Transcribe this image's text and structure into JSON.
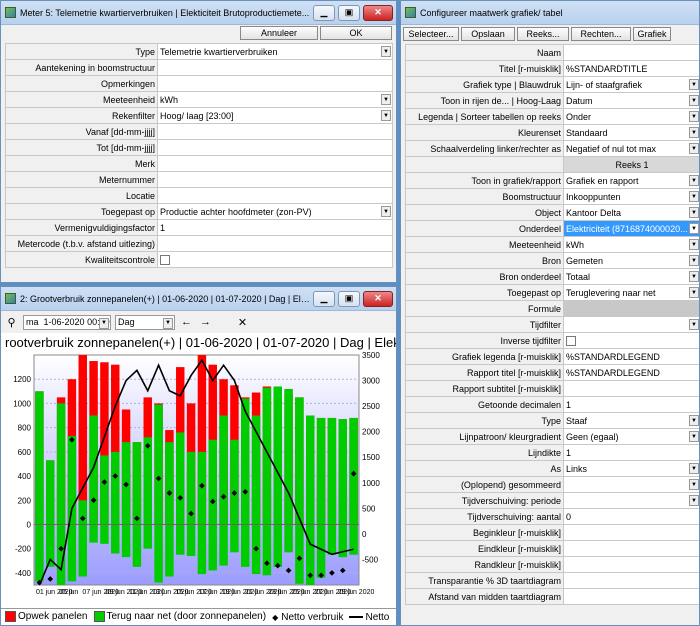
{
  "meter": {
    "title": "Meter 5: Telemetrie kwartierverbruiken | Elekticiteit Brutoproductiemete...",
    "cancel_label": "Annuleer",
    "ok_label": "OK",
    "fields": [
      {
        "label": "Type",
        "value": "Telemetrie kwartierverbruiken",
        "dropdown": true
      },
      {
        "label": "Aantekening in boomstructuur",
        "value": ""
      },
      {
        "label": "Opmerkingen",
        "value": ""
      },
      {
        "label": "Meeteenheid",
        "value": "kWh",
        "dropdown": true
      },
      {
        "label": "Rekenfilter",
        "value": "Hoog/ laag [23:00]",
        "dropdown": true,
        "icon": "filter-icon"
      },
      {
        "label": "Vanaf [dd-mm-jjjj]",
        "value": ""
      },
      {
        "label": "Tot [dd-mm-jjjj]",
        "value": ""
      },
      {
        "label": "Merk",
        "value": ""
      },
      {
        "label": "Meternummer",
        "value": ""
      },
      {
        "label": "Locatie",
        "value": ""
      },
      {
        "label": "Toegepast op",
        "value": "Productie achter hoofdmeter (zon-PV)",
        "dropdown": true
      },
      {
        "label": "Vermenigvuldigingsfactor",
        "value": "1"
      },
      {
        "label": "Metercode (t.b.v. afstand uitlezing)",
        "value": ""
      },
      {
        "label": "Kwaliteitscontrole",
        "value": "",
        "checkbox": true
      }
    ]
  },
  "chartwin": {
    "title": "2: Grootverbruik zonnepanelen(+) | 01-06-2020 | 01-07-2020 | Dag | Elektri...",
    "day_abbr": "ma",
    "date": "1-06-2020 00:00",
    "period": "Dag",
    "chart_title": "rootverbruik zonnepanelen(+) | 01-06-2020 | 01-07-2020 | Dag | Elektriciteit"
  },
  "config": {
    "title": "Configureer maatwerk grafiek/ tabel",
    "toolbar": [
      "Selecteer...",
      "Opslaan",
      "Reeks...",
      "Rechten...",
      "Grafiek"
    ],
    "section_label": "Reeks 1",
    "rows_top": [
      {
        "label": "Naam",
        "value": ""
      },
      {
        "label": "Titel [r-muisklik]",
        "value": "%STANDARDTITLE"
      },
      {
        "label": "Grafiek type | Blauwdruk",
        "value": "Lijn- of staafgrafiek",
        "dropdown": true
      },
      {
        "label": "Toon in rijen de... | Hoog-Laag",
        "value": "Datum",
        "dropdown": true
      },
      {
        "label": "Legenda | Sorteer tabellen op reeks",
        "value": "Onder",
        "dropdown": true
      },
      {
        "label": "Kleurenset",
        "value": "Standaard",
        "dropdown": true
      },
      {
        "label": "Schaalverdeling linker/rechter as",
        "value": "Negatief of nul tot max",
        "dropdown": true
      }
    ],
    "rows_bottom": [
      {
        "label": "Toon in grafiek/rapport",
        "value": "Grafiek en rapport",
        "dropdown": true
      },
      {
        "label": "Boomstructuur",
        "value": "Inkooppunten",
        "dropdown": true
      },
      {
        "label": "Object",
        "value": "Kantoor Delta",
        "dropdown": true
      },
      {
        "label": "Onderdeel",
        "value": "Elektriciteit (8716874000020...",
        "dropdown": true,
        "selected": true
      },
      {
        "label": "Meeteenheid",
        "value": "kWh",
        "dropdown": true
      },
      {
        "label": "Bron",
        "value": "Gemeten",
        "dropdown": true
      },
      {
        "label": "Bron onderdeel",
        "value": "Totaal",
        "dropdown": true
      },
      {
        "label": "Toegepast op",
        "value": "Teruglevering naar net",
        "dropdown": true
      },
      {
        "label": "Formule",
        "value": "",
        "disabled": true
      },
      {
        "label": "Tijdfilter",
        "value": "",
        "dropdown": true
      },
      {
        "label": "Inverse tijdfilter",
        "value": "",
        "checkbox": true
      },
      {
        "label": "Grafiek legenda [r-muisklik]",
        "value": "%STANDARDLEGEND"
      },
      {
        "label": "Rapport titel [r-muisklik]",
        "value": "%STANDARDLEGEND"
      },
      {
        "label": "Rapport subtitel [r-muisklik]",
        "value": ""
      },
      {
        "label": "Getoonde decimalen",
        "value": "1"
      },
      {
        "label": "Type",
        "value": "Staaf",
        "dropdown": true
      },
      {
        "label": "Lijnpatroon/ kleurgradient",
        "value": "Geen (egaal)",
        "dropdown": true
      },
      {
        "label": "Lijndikte",
        "value": "1"
      },
      {
        "label": "As",
        "value": "Links",
        "dropdown": true
      },
      {
        "label": "(Oplopend) gesommeerd",
        "value": "",
        "dropdown": true
      },
      {
        "label": "Tijdverschuiving: periode",
        "value": "",
        "dropdown": true
      },
      {
        "label": "Tijdverschuiving: aantal",
        "value": "0"
      },
      {
        "label": "Beginkleur [r-muisklik]",
        "value": ""
      },
      {
        "label": "Eindkleur [r-muisklik]",
        "value": ""
      },
      {
        "label": "Randkleur [r-muisklik]",
        "value": ""
      },
      {
        "label": "Transparantie % 3D taartdiagram",
        "value": ""
      },
      {
        "label": "Afstand van midden taartdiagram",
        "value": ""
      }
    ]
  },
  "chart_data": {
    "type": "bar",
    "title": "rootverbruik zonnepanelen(+) | 01-06-2020 | 01-07-2020 | Dag | Elektriciteit",
    "x_ticks": [
      "01 jun 2020",
      "05 jun",
      "07 jun 2020",
      "09 jun 2020",
      "11 jun 2020",
      "13 jun 2020",
      "15 jun 2020",
      "17 jun 2020",
      "19 jun 2020",
      "21 jun 2020",
      "23 jun 2020",
      "25 jun 2020",
      "27 jun 2020",
      "29 jun 2020"
    ],
    "ylim_left": [
      -500,
      1400
    ],
    "y_ticks_left": [
      1200,
      1000,
      800,
      600,
      400,
      200,
      0,
      -200,
      -400
    ],
    "ylim_right": [
      -1000,
      3500
    ],
    "y_ticks_right": [
      3500,
      3000,
      2500,
      2000,
      1500,
      1000,
      500,
      0,
      -500
    ],
    "series": [
      {
        "name": "Opwek panelen",
        "color": "#ff0000",
        "values": [
          1100,
          530,
          1050,
          1200,
          1400,
          1350,
          1340,
          1320,
          950,
          680,
          1050,
          1000,
          780,
          1300,
          1000,
          1400,
          1320,
          1200,
          1150,
          1050,
          1090,
          1140,
          1120,
          1080,
          1050,
          900,
          880,
          880,
          870,
          880
        ]
      },
      {
        "name": "Terug naar net (door zonnepanelen)",
        "color": "#00cc00",
        "values": [
          1100,
          530,
          1000,
          730,
          200,
          900,
          570,
          600,
          680,
          680,
          720,
          990,
          680,
          760,
          600,
          600,
          700,
          900,
          700,
          1040,
          900,
          1130,
          1140,
          1120,
          1050,
          900,
          880,
          880,
          870,
          880
        ]
      },
      {
        "name": "Terug naar net negatief",
        "color": "#00cc00",
        "values": [
          -470,
          -350,
          -500,
          -470,
          -430,
          -150,
          -160,
          -240,
          -270,
          -350,
          -200,
          -480,
          -430,
          -250,
          -260,
          -410,
          -380,
          -340,
          -230,
          -350,
          -410,
          -420,
          -350,
          -230,
          -490,
          -500,
          -440,
          -250,
          -270,
          -250
        ]
      },
      {
        "name": "Netto verbruik",
        "color": "#000000",
        "values": [
          -480,
          -450,
          -200,
          700,
          50,
          200,
          350,
          400,
          330,
          50,
          650,
          380,
          260,
          220,
          90,
          320,
          190,
          230,
          260,
          270,
          -200,
          -320,
          -340,
          -380,
          -280,
          -420,
          -420,
          -400,
          -380,
          420
        ]
      },
      {
        "name": "Netto",
        "color": "#000000",
        "right_axis": true,
        "values": [
          -1000,
          -500,
          -700,
          500,
          900,
          1300,
          1900,
          2500,
          3000,
          3200,
          2800,
          3300,
          2800,
          2700,
          3100,
          3400,
          3000,
          3300,
          3000,
          2400,
          2000,
          1600,
          1200,
          800,
          300,
          -200,
          -300,
          -400,
          -350,
          -300
        ]
      }
    ],
    "legend": [
      "Opwek panelen",
      "Terug naar net (door zonnepanelen)",
      "Netto verbruik",
      "Netto"
    ]
  }
}
